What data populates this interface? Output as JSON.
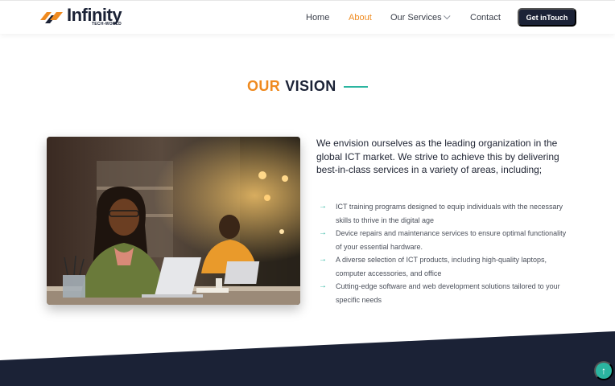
{
  "header": {
    "logo_word": "Infinity",
    "logo_sub": "TECH-WORLD",
    "nav": {
      "home": "Home",
      "about": "About",
      "services": "Our Services",
      "contact": "Contact"
    },
    "cta": "Get inTouch"
  },
  "vision": {
    "heading_accent": "OUR",
    "heading_main": "VISION",
    "intro": "We envision ourselves as the leading organization in the global ICT market. We strive to achieve this by delivering best-in-class services in a variety of areas, including;",
    "bullets": [
      "ICT training programs designed to equip individuals with the necessary skills to thrive in the digital age",
      "Device repairs and maintenance services to ensure optimal functionality of your essential hardware.",
      "A diverse selection of ICT products, including high-quality laptops, computer accessories, and office",
      "Cutting-edge software and web development solutions tailored to your specific needs"
    ],
    "bullet_icon": "arrow-right-icon",
    "photo_alt_icon": "office-photo"
  },
  "colors": {
    "accent_orange": "#ef8a1f",
    "navy": "#1b2236",
    "teal": "#2bb5a0"
  },
  "scroll_top": {
    "icon": "arrow-up-icon",
    "glyph": "↑"
  },
  "bullet_glyph": "→"
}
